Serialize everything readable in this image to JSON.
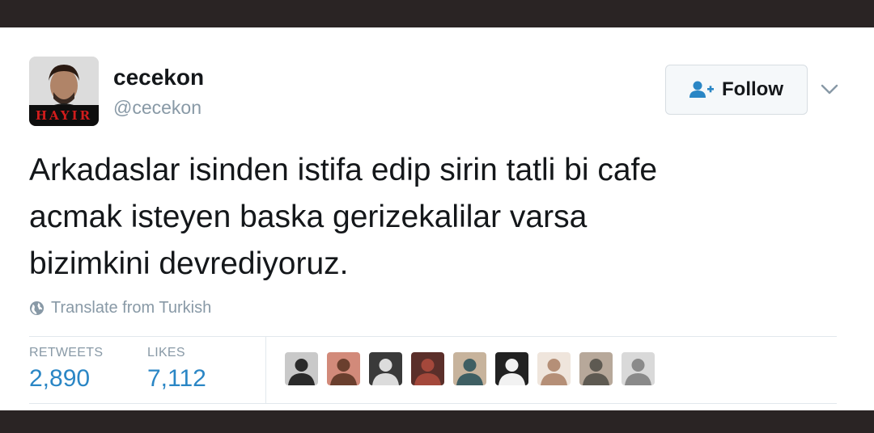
{
  "tweet": {
    "avatar_tag": "HAYIR",
    "display_name": "cecekon",
    "handle": "@cecekon",
    "follow_label": "Follow",
    "text_lines": [
      "Arkadaslar isinden istifa edip sirin tatli bi cafe",
      "acmak isteyen baska gerizekalilar varsa",
      "bizimkini devrediyoruz."
    ],
    "translate_label": "Translate from Turkish"
  },
  "stats": {
    "retweets_label": "RETWEETS",
    "retweets_value": "2,890",
    "likes_label": "LIKES",
    "likes_value": "7,112"
  },
  "likers": [
    {
      "colors": [
        "#2b2b2b",
        "#c9c9c9"
      ]
    },
    {
      "colors": [
        "#6a3f2e",
        "#d28a7a"
      ]
    },
    {
      "colors": [
        "#dcdcdc",
        "#3a3a3a"
      ]
    },
    {
      "colors": [
        "#a4483b",
        "#5b2f2a"
      ]
    },
    {
      "colors": [
        "#3f5f63",
        "#c7b39c"
      ]
    },
    {
      "colors": [
        "#f2f2f2",
        "#222222"
      ]
    },
    {
      "colors": [
        "#b58f77",
        "#efe5dc"
      ]
    },
    {
      "colors": [
        "#5e5a52",
        "#b7a89a"
      ]
    },
    {
      "colors": [
        "#8a8a8a",
        "#d9d9d9"
      ]
    }
  ],
  "colors": {
    "accent_blue": "#2a86c5",
    "muted_gray": "#8899a6",
    "avatar_tag_red": "#d11c1c"
  }
}
